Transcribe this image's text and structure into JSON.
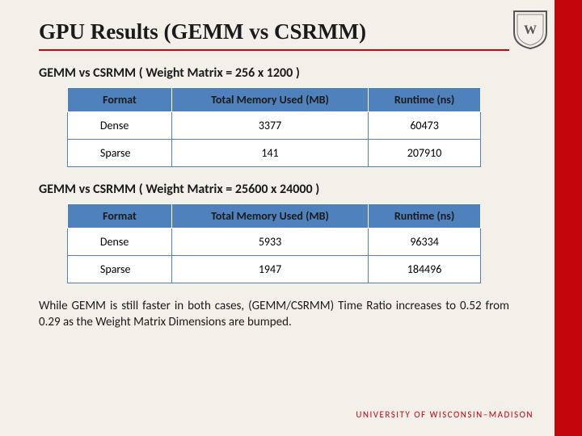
{
  "title": "GPU Results (GEMM vs CSRMM)",
  "sections": [
    {
      "subtitle": "GEMM vs CSRMM ( Weight Matrix = 256 x 1200 )",
      "headers": [
        "Format",
        "Total Memory Used (MB)",
        "Runtime (ns)"
      ],
      "rows": [
        {
          "format": "Dense",
          "mem": "3377",
          "runtime": "60473"
        },
        {
          "format": "Sparse",
          "mem": "141",
          "runtime": "207910"
        }
      ]
    },
    {
      "subtitle": "GEMM vs CSRMM ( Weight Matrix = 25600 x 24000 )",
      "headers": [
        "Format",
        "Total Memory Used (MB)",
        "Runtime (ns)"
      ],
      "rows": [
        {
          "format": "Dense",
          "mem": "5933",
          "runtime": "96334"
        },
        {
          "format": "Sparse",
          "mem": "1947",
          "runtime": "184496"
        }
      ]
    }
  ],
  "note": "While GEMM is still faster in both cases, (GEMM/CSRMM) Time Ratio increases to 0.52 from 0.29 as the Weight Matrix Dimensions are bumped.",
  "footer": "UNIVERSITY OF WISCONSIN–MADISON",
  "chart_data": [
    {
      "type": "table",
      "title": "GEMM vs CSRMM ( Weight Matrix = 256 x 1200 )",
      "columns": [
        "Format",
        "Total Memory Used (MB)",
        "Runtime (ns)"
      ],
      "rows": [
        [
          "Dense",
          3377,
          60473
        ],
        [
          "Sparse",
          141,
          207910
        ]
      ]
    },
    {
      "type": "table",
      "title": "GEMM vs CSRMM ( Weight Matrix = 25600 x 24000 )",
      "columns": [
        "Format",
        "Total Memory Used (MB)",
        "Runtime (ns)"
      ],
      "rows": [
        [
          "Dense",
          5933,
          96334
        ],
        [
          "Sparse",
          1947,
          184496
        ]
      ]
    }
  ]
}
